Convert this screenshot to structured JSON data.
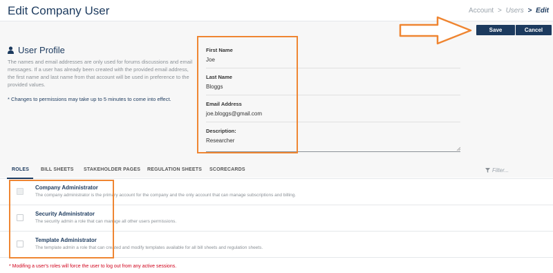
{
  "header": {
    "title": "Edit Company User",
    "breadcrumb": [
      "Account",
      "Users",
      "Edit"
    ],
    "sep": ">"
  },
  "toolbar": {
    "save_label": "Save",
    "cancel_label": "Cancel"
  },
  "profile": {
    "title": "User Profile",
    "description": "The names and email addresses are only used for forums discussions and email messages. If a user has already been created with the provided email address, the first name and last name from that account will be used in preference to the provided values.",
    "permissions_note": "* Changes to permissions may take up to 5 minutes to come into effect."
  },
  "form": {
    "first_name_label": "First Name",
    "first_name": "Joe",
    "last_name_label": "Last Name",
    "last_name": "Bloggs",
    "email_label": "Email Address",
    "email": "joe.bloggs@gmail.com",
    "description_label": "Description:",
    "description": "Researcher"
  },
  "tabs": [
    {
      "label": "ROLES",
      "active": true
    },
    {
      "label": "BILL SHEETS"
    },
    {
      "label": "STAKEHOLDER PAGES"
    },
    {
      "label": "REGULATION SHEETS"
    },
    {
      "label": "SCORECARDS"
    }
  ],
  "filter": {
    "placeholder": "Filter..."
  },
  "roles": [
    {
      "name": "Company Administrator",
      "description": "The company administrator is the primary account for the company and the only account that can manage subscriptions and billing.",
      "checked": false,
      "disabled": true
    },
    {
      "name": "Security Administrator",
      "description": "The security admin a role that can manage all other users permissions.",
      "checked": false
    },
    {
      "name": "Template Administrator",
      "description": "The template admin a role that can created and modify templates available for all bill sheets and regulation sheets.",
      "checked": false
    }
  ],
  "logout_note": "* Modifing a user's roles will force the user to log out from any active sessions.",
  "colors": {
    "primary": "#1c3a5e",
    "highlight": "#ef8531",
    "warning": "#d0021b"
  }
}
